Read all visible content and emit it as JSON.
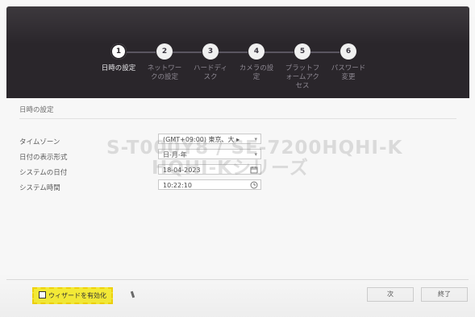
{
  "wizard": {
    "steps": [
      {
        "number": "1",
        "label": "日時の設定"
      },
      {
        "number": "2",
        "label": "ネットワー\nクの設定"
      },
      {
        "number": "3",
        "label": "ハードディ\nスク"
      },
      {
        "number": "4",
        "label": "カメラの設\n定"
      },
      {
        "number": "5",
        "label": "プラットフ\nォームアク\nセス"
      },
      {
        "number": "6",
        "label": "パスワード\n変更"
      }
    ],
    "active_step": 1
  },
  "section": {
    "title": "日時の設定"
  },
  "form": {
    "timezone": {
      "label": "タイムゾーン",
      "value": "(GMT+09:00) 東京、大 ▸"
    },
    "date_format": {
      "label": "日付の表示形式",
      "value": "日-月-年"
    },
    "system_date": {
      "label": "システムの日付",
      "value": "18-04-2023"
    },
    "system_time": {
      "label": "システム時間",
      "value": "10:22:10"
    }
  },
  "watermark": {
    "line1": "S-T000Y8 / SE-7200HQHI-K",
    "line2": "HQHI-Kシリーズ"
  },
  "footer": {
    "enable_wizard_label": "ウィザードを有効化",
    "next_label": "次",
    "finish_label": "終了"
  },
  "colors": {
    "topbar": "#2a262b",
    "highlight": "#f7ed37",
    "background": "#f7f7f7"
  },
  "icons": {
    "calendar": "calendar-icon",
    "clock": "clock-icon",
    "dropdown": "chevron-down-icon",
    "checkbox": "checkbox-icon"
  }
}
